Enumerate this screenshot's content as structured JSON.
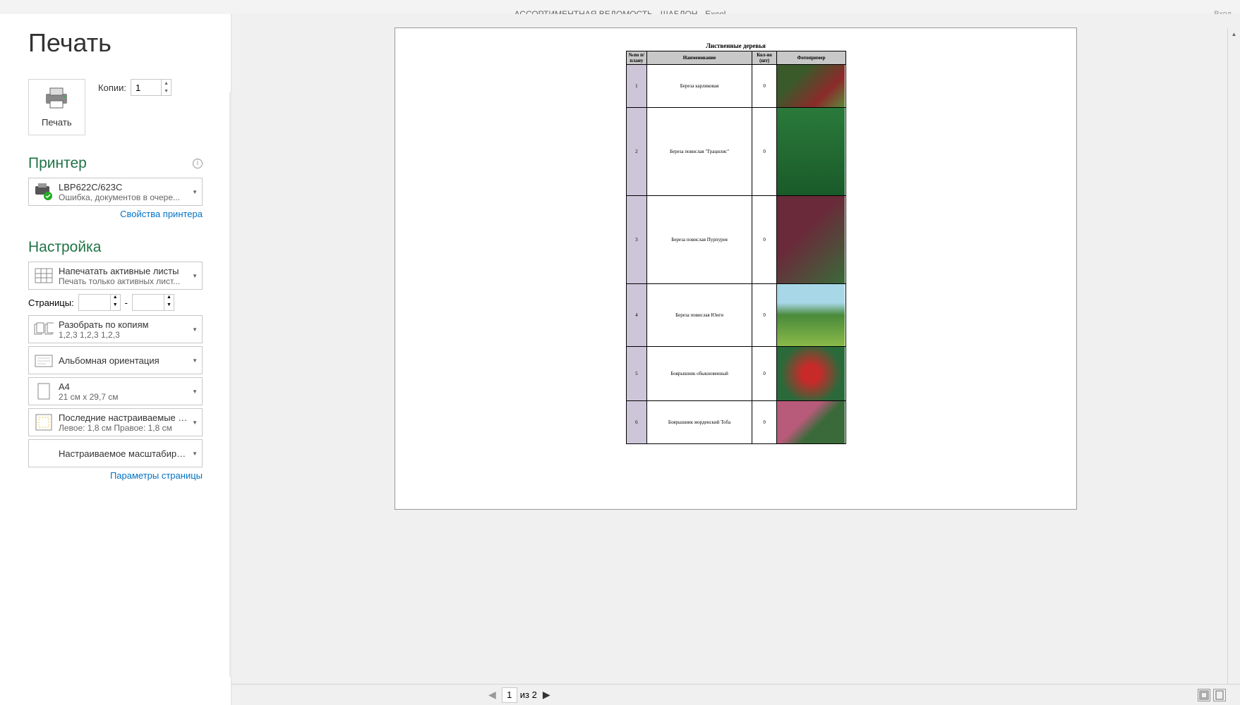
{
  "titlebar": {
    "doc": "АССОРТИМЕНТНАЯ ВЕДОМОСТЬ - ШАБЛОН - Excel",
    "login": "Вход"
  },
  "page_title": "Печать",
  "print_btn": "Печать",
  "copies": {
    "label": "Копии:",
    "value": "1"
  },
  "printer": {
    "heading": "Принтер",
    "name": "LBP622C/623C",
    "status": "Ошибка, документов в очере...",
    "properties": "Свойства принтера"
  },
  "settings": {
    "heading": "Настройка",
    "print_what": {
      "title": "Напечатать активные листы",
      "sub": "Печать только активных лист..."
    },
    "pages": {
      "label": "Страницы:",
      "sep": "-"
    },
    "collate": {
      "title": "Разобрать по копиям",
      "sub": "1,2,3    1,2,3    1,2,3"
    },
    "orientation": {
      "title": "Альбомная ориентация"
    },
    "paper": {
      "title": "A4",
      "sub": "21 см x 29,7 см"
    },
    "margins": {
      "title": "Последние настраиваемые п...",
      "sub": "Левое:  1,8 см   Правое:  1,8 см"
    },
    "scaling": {
      "title": "Настраиваемое масштабиро..."
    },
    "page_setup": "Параметры страницы"
  },
  "preview": {
    "section_title": "Лиственные деревья",
    "headers": {
      "num": "№по п/плану",
      "name": "Наименование",
      "qty": "Кол-во (шт)",
      "photo": "Фотопример"
    },
    "rows": [
      {
        "n": "1",
        "name": "Береза карликовая",
        "qty": "0"
      },
      {
        "n": "2",
        "name": "Береза повислая \"Грацилис\"",
        "qty": "0"
      },
      {
        "n": "3",
        "name": "Береза повислая Пурпурея",
        "qty": "0"
      },
      {
        "n": "4",
        "name": "Береза повислая Юнги",
        "qty": "0"
      },
      {
        "n": "5",
        "name": "Боярышник обыкновенный",
        "qty": "0"
      },
      {
        "n": "6",
        "name": "Боярышник морденский Тоба",
        "qty": "0"
      }
    ]
  },
  "pager": {
    "current": "1",
    "of": "из 2"
  }
}
